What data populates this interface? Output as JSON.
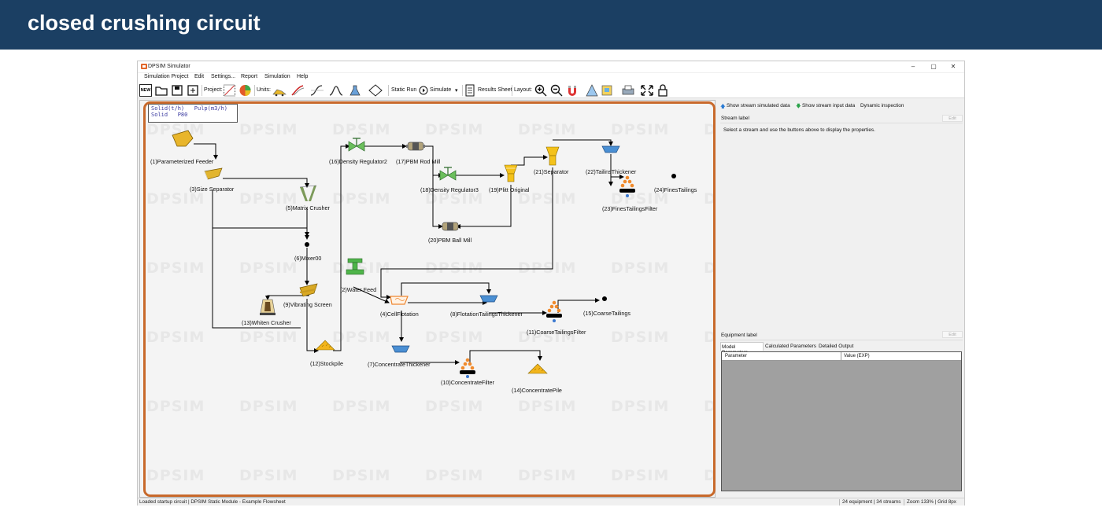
{
  "banner": {
    "title": "closed crushing circuit"
  },
  "window": {
    "title": "DPSIM Simulator",
    "minimize": "–",
    "maximize": "▢",
    "close": "✕"
  },
  "menu": [
    "Simulation Project",
    "Edit",
    "Settings...",
    "Report",
    "Simulation",
    "Help"
  ],
  "toolbar": {
    "new_label": "NEW",
    "project_label": "Project:",
    "units_label": "Units:",
    "static_run_label": "Static Run",
    "simulate_label": "Simulate",
    "results_sheet_label": "Results Sheet",
    "layout_label": "Layout:"
  },
  "legend": {
    "line1": "Solid(t/h)   Pulp(m3/h)",
    "line2": "Solid   P80"
  },
  "watermark": {
    "text": "DPSIM"
  },
  "nodes": [
    {
      "label": "(1)Parameterized Feeder"
    },
    {
      "label": "(3)Size Separator"
    },
    {
      "label": "(5)Matrix Crusher"
    },
    {
      "label": "(6)Mixer00"
    },
    {
      "label": "(9)Vibrating Screen"
    },
    {
      "label": "(13)Whiten Crusher"
    },
    {
      "label": "(12)Stockpile"
    },
    {
      "label": "(16)Density Regulator2"
    },
    {
      "label": "(17)PBM Rod Mill"
    },
    {
      "label": "(18)Density Regulator3"
    },
    {
      "label": "(19)Plitt Original"
    },
    {
      "label": "(20)PBM Ball Mill"
    },
    {
      "label": "(21)Separator"
    },
    {
      "label": "(22)TailinsThickener"
    },
    {
      "label": "(23)FinesTailingsFilter"
    },
    {
      "label": "(24)FinesTailings"
    },
    {
      "label": "(2)Water Feed"
    },
    {
      "label": "(4)CellFlotation"
    },
    {
      "label": "(8)FlotationTailingsThickener"
    },
    {
      "label": "(11)CoarseTailingsFilter"
    },
    {
      "label": "(15)CoarseTailings"
    },
    {
      "label": "(7)ConcentrateThickener"
    },
    {
      "label": "(10)ConcentrateFilter"
    },
    {
      "label": "(14)ConcentratePile"
    }
  ],
  "right_panel": {
    "show_simulated": "Show stream simulated data",
    "show_input": "Show stream input data",
    "dynamic_inspection": "Dynamic inspection",
    "stream_label": "Stream label",
    "edit": "Edit",
    "stream_hint": "Select a stream and use the buttons above to display the properties.",
    "equipment_label": "Equipment label",
    "tabs": [
      "Model Parameters",
      "Calculated Parameters",
      "Detailed Output"
    ],
    "grid_columns": [
      "Parameter",
      "Value (EXP)"
    ]
  },
  "status": {
    "left": "Loaded startup circuit | DPSIM Static Module - Example Flowsheet",
    "equipment": "24 equipment | 34 streams",
    "zoom": "Zoom 133% | Grid 8px"
  },
  "colors": {
    "banner": "#1b3f63",
    "highlight": "#c8692b",
    "feeder": "#e7b52c",
    "pipe": "#000000"
  }
}
